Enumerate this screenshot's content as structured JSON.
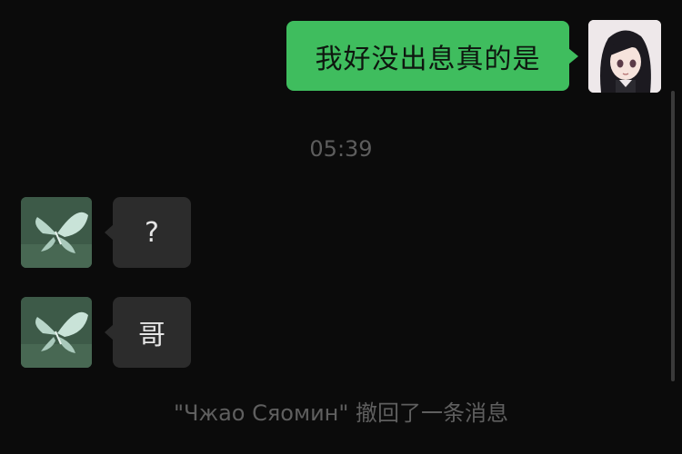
{
  "messages": {
    "outgoing": [
      {
        "text": "我好没出息真的是"
      }
    ],
    "timestamp": "05:39",
    "incoming": [
      {
        "text": "?"
      },
      {
        "text": "哥"
      }
    ],
    "recall_notice": "\"Чжао Сяомин\" 撤回了一条消息"
  },
  "colors": {
    "background": "#0b0b0b",
    "outgoing_bubble": "#3fbd5e",
    "incoming_bubble": "#2c2c2c",
    "system_text": "#5f5f5f"
  },
  "icons": {
    "self_avatar": "anime-girl-avatar",
    "peer_avatar": "butterfly-avatar"
  }
}
